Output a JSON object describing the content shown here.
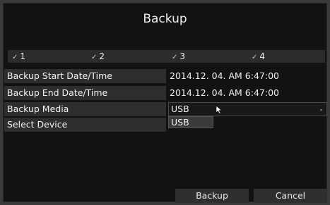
{
  "dialog": {
    "title": "Backup"
  },
  "channels": [
    {
      "label": "1",
      "checked": true
    },
    {
      "label": "2",
      "checked": true
    },
    {
      "label": "3",
      "checked": true
    },
    {
      "label": "4",
      "checked": true
    }
  ],
  "fields": {
    "start": {
      "label": "Backup Start Date/Time",
      "value": "2014.12. 04. AM 6:47:00"
    },
    "end": {
      "label": "Backup End Date/Time",
      "value": "2014.12. 04. AM 6:47:00"
    },
    "media": {
      "label": "Backup Media",
      "value": "USB",
      "options": [
        "USB"
      ]
    },
    "device": {
      "label": "Select Device"
    }
  },
  "buttons": {
    "backup": "Backup",
    "cancel": "Cancel"
  },
  "icons": {
    "check": "check-icon",
    "chevron": "chevron-down-icon",
    "cursor": "mouse-cursor-icon"
  }
}
